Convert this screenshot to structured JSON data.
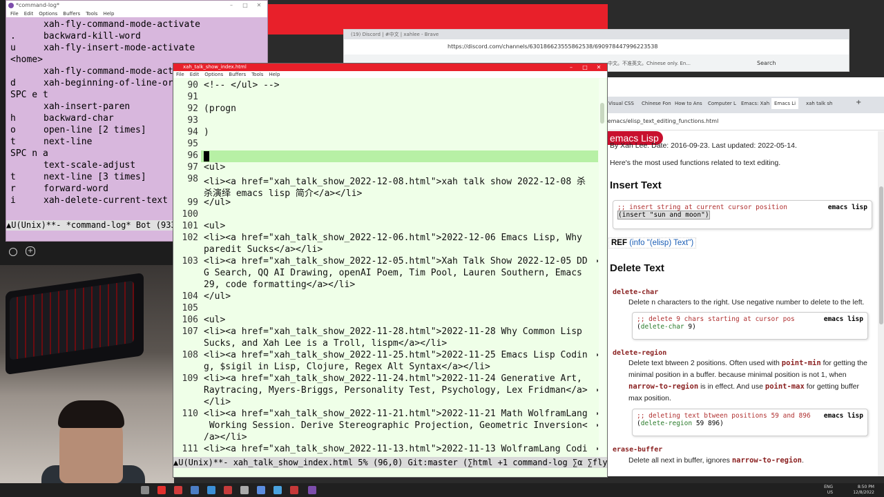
{
  "cmdlog": {
    "title": "*command-log*",
    "menu": [
      "File",
      "Edit",
      "Options",
      "Buffers",
      "Tools",
      "Help"
    ],
    "rows": [
      {
        "key": "",
        "cmd": "xah-fly-command-mode-activate"
      },
      {
        "key": ".",
        "cmd": "backward-kill-word"
      },
      {
        "key": "u",
        "cmd": "xah-fly-insert-mode-activate"
      },
      {
        "key": "<home>",
        "cmd": ""
      },
      {
        "key": "",
        "cmd": "xah-fly-command-mode-act"
      },
      {
        "key": "d",
        "cmd": "xah-beginning-of-line-or"
      },
      {
        "key": "SPC e t",
        "cmd": ""
      },
      {
        "key": "",
        "cmd": "xah-insert-paren"
      },
      {
        "key": "h",
        "cmd": "backward-char"
      },
      {
        "key": "o",
        "cmd": "open-line [2 times]"
      },
      {
        "key": "t",
        "cmd": "next-line"
      },
      {
        "key": "SPC n a",
        "cmd": ""
      },
      {
        "key": "",
        "cmd": "text-scale-adjust"
      },
      {
        "key": "t",
        "cmd": "next-line [3 times]"
      },
      {
        "key": "r",
        "cmd": "forward-word"
      },
      {
        "key": "i",
        "cmd": "xah-delete-current-text"
      }
    ],
    "modeline": "▲U(Unix)**- *command-log* Bot (933,"
  },
  "discord": {
    "tab": "(19) Discord | #中文 | xahlee - Brave",
    "url": "https://discord.com/channels/630186623555862538/690978447996223538",
    "search": "Search",
    "snippet": "中文。不准英文。Chinese only. En..."
  },
  "emacs": {
    "title": "xah_talk_show_index.html",
    "menu": [
      "File",
      "Edit",
      "Options",
      "Buffers",
      "Tools",
      "Help"
    ],
    "lines": [
      {
        "n": "90",
        "t": "<!-- </ul> -->"
      },
      {
        "n": "91",
        "t": ""
      },
      {
        "n": "92",
        "t": "(progn"
      },
      {
        "n": "93",
        "t": ""
      },
      {
        "n": "94",
        "t": ")"
      },
      {
        "n": "95",
        "t": ""
      },
      {
        "n": "96",
        "t": ""
      },
      {
        "n": "97",
        "t": "<ul>"
      },
      {
        "n": "98",
        "t": "<li><a href=\"xah_talk_show_2022-12-08.html\">xah talk show 2022-12-08 杀"
      },
      {
        "n": "",
        "t": "杀演绎 emacs lisp 简介</a></li>"
      },
      {
        "n": "99",
        "t": "</ul>"
      },
      {
        "n": "100",
        "t": ""
      },
      {
        "n": "101",
        "t": "<ul>"
      },
      {
        "n": "102",
        "t": "<li><a href=\"xah_talk_show_2022-12-06.html\">2022-12-06 Emacs Lisp, Why"
      },
      {
        "n": "",
        "t": "paredit Sucks</a></li>"
      },
      {
        "n": "103",
        "t": "<li><a href=\"xah_talk_show_2022-12-05.html\">Xah Talk Show 2022-12-05 DD"
      },
      {
        "n": "",
        "t": "G Search, QQ AI Drawing, openAI Poem, Tim Pool, Lauren Southern, Emacs"
      },
      {
        "n": "",
        "t": "29, code formatting</a></li>"
      },
      {
        "n": "104",
        "t": "</ul>"
      },
      {
        "n": "105",
        "t": ""
      },
      {
        "n": "106",
        "t": "<ul>"
      },
      {
        "n": "107",
        "t": "<li><a href=\"xah_talk_show_2022-11-28.html\">2022-11-28 Why Common Lisp"
      },
      {
        "n": "",
        "t": "Sucks, and Xah Lee is a Troll, lispm</a></li>"
      },
      {
        "n": "108",
        "t": "<li><a href=\"xah_talk_show_2022-11-25.html\">2022-11-25 Emacs Lisp Codin"
      },
      {
        "n": "",
        "t": "g, $sigil in Lisp, Clojure, Regex Alt Syntax</a></li>"
      },
      {
        "n": "109",
        "t": "<li><a href=\"xah_talk_show_2022-11-24.html\">2022-11-24 Generative Art,"
      },
      {
        "n": "",
        "t": "Raytracing, Myers-Briggs, Personality Test, Psychology, Lex Fridman</a>"
      },
      {
        "n": "",
        "t": "</li>"
      },
      {
        "n": "110",
        "t": "<li><a href=\"xah_talk_show_2022-11-21.html\">2022-11-21 Math WolframLang"
      },
      {
        "n": "",
        "t": " Working Session. Derive Stereographic Projection, Geometric Inversion<"
      },
      {
        "n": "",
        "t": "/a></li>"
      },
      {
        "n": "111",
        "t": "<li><a href=\"xah_talk_show_2022-11-13.html\">2022-11-13 WolframLang Codi"
      }
    ],
    "modeline": "▲U(Unix)**- xah_talk_show_index.html 5% (96,0) Git:master (∑html +1 command-log ∑α ∑flykeys Abb"
  },
  "browser": {
    "tabs": [
      "Visual CSS",
      "Chinese Fon",
      "How to Ans",
      "Computer L",
      "Emacs: Xah",
      "Emacs Li",
      "xah talk sh"
    ],
    "url": "/emacs/elisp_text_editing_functions.html",
    "badge": "emacs Lisp",
    "byline": "By Xah Lee. Date: 2016-09-23. Last updated: 2022-05-14.",
    "intro": "Here's the most used functions related to text editing.",
    "insert_title": "Insert Text",
    "insert_comment": ";; insert string at current cursor position",
    "insert_code": "(insert \"sun and moon\")",
    "lang": "emacs lisp",
    "ref_label": "REF",
    "ref_text": "(info \"(elisp) Text\")",
    "delete_title": "Delete Text",
    "delete_char": {
      "name": "delete-char",
      "desc": "Delete n characters to the right. Use negative number to delete to the left.",
      "comment": ";; delete 9 chars starting at cursor pos",
      "fn": "delete-char",
      "args": " 9)"
    },
    "delete_region": {
      "name": "delete-region",
      "desc1": "Delete text btween 2 positions. Often used with",
      "code1": "point-min",
      "desc2": "for getting the minimal position in a buffer. because minimal position is not 1, when",
      "code2": "narrow-to-region",
      "desc3": "is in effect. And use",
      "code3": "point-max",
      "desc4": "for getting buffer max position.",
      "comment": ";; deleting text btween positions 59 and 896",
      "fn": "delete-region",
      "args": " 59 896)"
    },
    "erase_buffer": {
      "name": "erase-buffer",
      "desc1": "Delete all next in buffer, ignores",
      "code1": "narrow-to-region",
      "desc2": "."
    }
  },
  "taskbar": {
    "lang": "ENG",
    "region": "US",
    "time": "8:50 PM",
    "date": "12/8/2022"
  }
}
